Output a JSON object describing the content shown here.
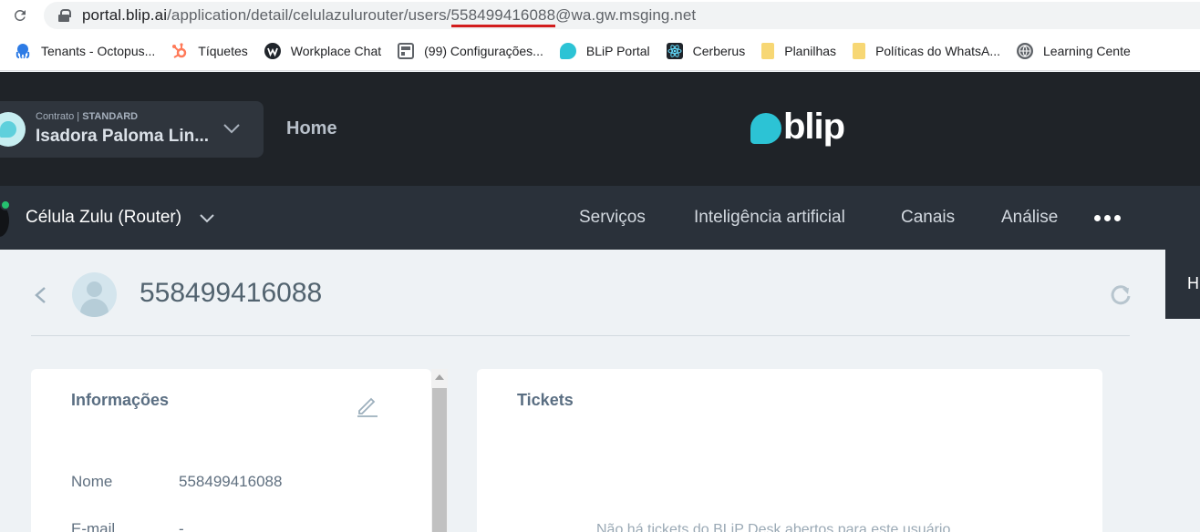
{
  "browser": {
    "url_host": "portal.blip.ai",
    "url_path_before": "/application/detail/celulazulurouter/users/",
    "url_highlight": "558499416088",
    "url_after": "@wa.gw.msging.net"
  },
  "bookmarks": [
    {
      "label": "Tenants - Octopus...",
      "icon": "octopus-icon",
      "color": "#2d7be5"
    },
    {
      "label": "Tíquetes",
      "icon": "hubspot-icon",
      "color": "#ff7a59"
    },
    {
      "label": "Workplace Chat",
      "icon": "workplace-icon",
      "color": "#20252b"
    },
    {
      "label": "(99) Configurações...",
      "icon": "settings-page-icon",
      "color": "#5f6368"
    },
    {
      "label": "BLiP Portal",
      "icon": "blip-icon",
      "color": "#2cc3d5"
    },
    {
      "label": "Cerberus",
      "icon": "react-icon",
      "color": "#20252b"
    },
    {
      "label": "Planilhas",
      "icon": "folder-icon",
      "color": "#f7d774"
    },
    {
      "label": "Políticas do WhatsA...",
      "icon": "folder-icon",
      "color": "#f7d774"
    },
    {
      "label": "Learning Cente",
      "icon": "globe-icon",
      "color": "#5f6368"
    }
  ],
  "header": {
    "contract_label": "Contrato",
    "contract_plan": "STANDARD",
    "contract_name": "Isadora Paloma Lin...",
    "home": "Home",
    "logo_text": "blip"
  },
  "subnav": {
    "bot_name": "Célula Zulu (Router)",
    "items": [
      "Serviços",
      "Inteligência artificial",
      "Canais",
      "Análise"
    ]
  },
  "user": {
    "title": "558499416088"
  },
  "right_tab": {
    "label": "H"
  },
  "info_card": {
    "title": "Informações",
    "fields": [
      {
        "label": "Nome",
        "value": "558499416088"
      },
      {
        "label": "E-mail",
        "value": "-"
      }
    ]
  },
  "tickets_card": {
    "title": "Tickets",
    "empty_message": "Não há tickets do BLiP Desk abertos para este usuário"
  },
  "colors": {
    "accent": "#2cc3d5",
    "url_underline": "#d21d1d",
    "online": "#25c16f"
  }
}
